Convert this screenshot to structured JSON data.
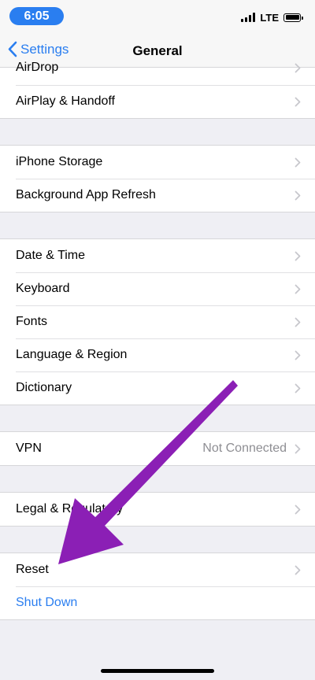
{
  "status_bar": {
    "time": "6:05",
    "network": "LTE",
    "signal_bars": 4
  },
  "nav": {
    "back_label": "Settings",
    "title": "General"
  },
  "groups": [
    {
      "rows": [
        {
          "label": "AirDrop"
        },
        {
          "label": "AirPlay & Handoff"
        }
      ]
    },
    {
      "rows": [
        {
          "label": "iPhone Storage"
        },
        {
          "label": "Background App Refresh"
        }
      ]
    },
    {
      "rows": [
        {
          "label": "Date & Time"
        },
        {
          "label": "Keyboard"
        },
        {
          "label": "Fonts"
        },
        {
          "label": "Language & Region"
        },
        {
          "label": "Dictionary"
        }
      ]
    },
    {
      "rows": [
        {
          "label": "VPN",
          "value": "Not Connected"
        }
      ]
    },
    {
      "rows": [
        {
          "label": "Legal & Regulatory"
        }
      ]
    },
    {
      "rows": [
        {
          "label": "Reset"
        },
        {
          "label": "Shut Down"
        }
      ]
    }
  ],
  "colors": {
    "accent": "#2a7ef0",
    "annotation_arrow": "#8b1fb5",
    "background": "#efeff4"
  },
  "icons": {
    "back": "chevron-left-icon",
    "disclosure": "chevron-right-icon",
    "battery": "battery-icon",
    "signal": "cellular-signal-icon"
  }
}
